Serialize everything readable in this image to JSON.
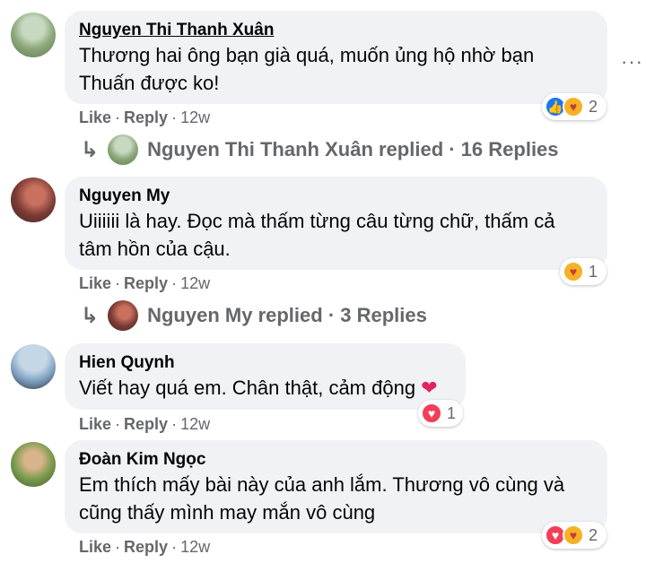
{
  "comments": [
    {
      "author": "Nguyen Thi Thanh Xuân",
      "line1": "Thương hai ông bạn già quá, muốn ủng hộ nhờ bạn",
      "line2": "Thuấn được ko!",
      "like": "Like",
      "reply": "Reply",
      "time": "12w",
      "reaction_count": "2",
      "reactions": [
        "like-icon",
        "care-icon"
      ],
      "replies_label": "Nguyen Thi Thanh Xuân replied · 16 Replies"
    },
    {
      "author": "Nguyen My",
      "line1": "Uiiiiii là hay. Đọc mà thấm từng câu từng chữ, thấm cả",
      "line2": "tâm hồn của cậu.",
      "like": "Like",
      "reply": "Reply",
      "time": "12w",
      "reaction_count": "1",
      "reactions": [
        "care-icon"
      ],
      "replies_label": "Nguyen My replied · 3 Replies"
    },
    {
      "author": "Hien Quynh",
      "line1": "Viết hay quá em. Chân thật, cảm động",
      "emoji": "❤",
      "like": "Like",
      "reply": "Reply",
      "time": "12w",
      "reaction_count": "1",
      "reactions": [
        "love-icon"
      ]
    },
    {
      "author": "Đoàn Kim Ngọc",
      "line1": "Em thích mấy bài này của anh lắm. Thương vô cùng và",
      "line2": "cũng thấy mình may mắn vô cùng",
      "like": "Like",
      "reply": "Reply",
      "time": "12w",
      "reaction_count": "2",
      "reactions": [
        "love-icon",
        "care-icon"
      ]
    }
  ],
  "more_menu": "···",
  "separator": "·",
  "reply_arrow": "↳"
}
